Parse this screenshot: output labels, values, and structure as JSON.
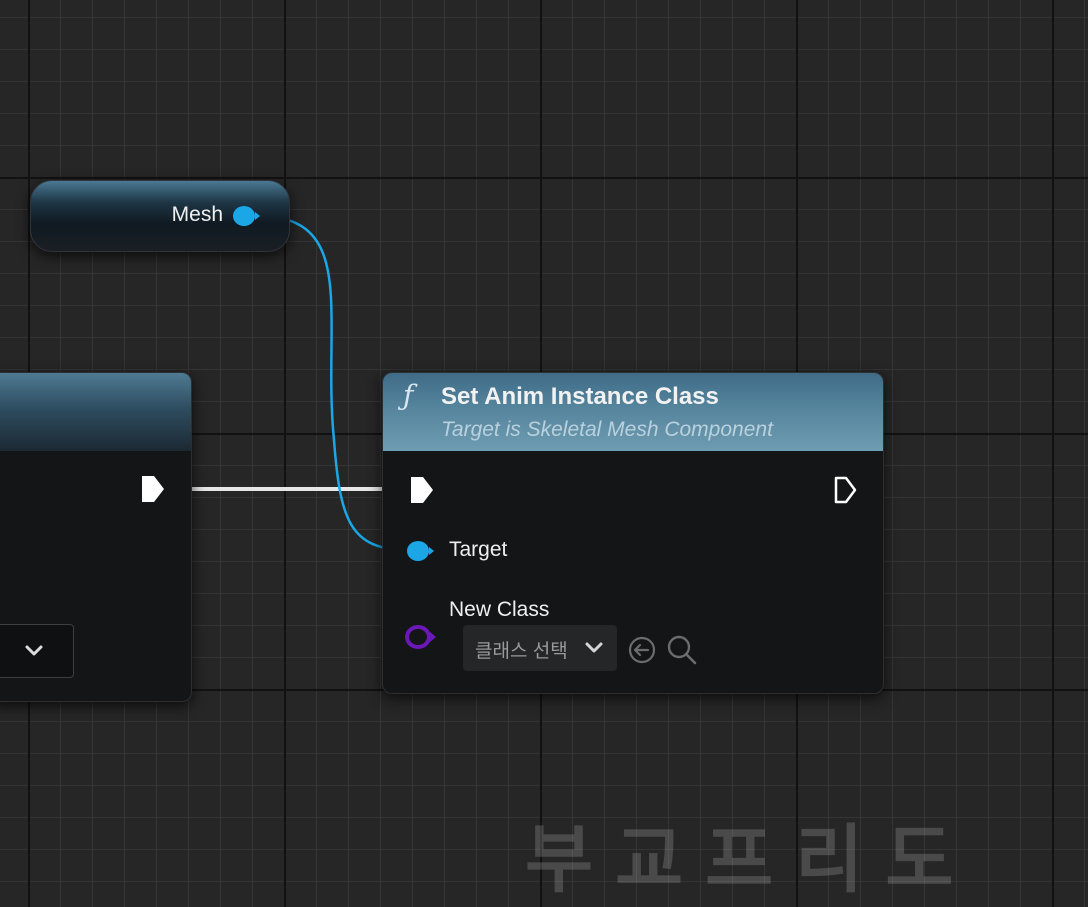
{
  "variable_node": {
    "label": "Mesh"
  },
  "function_node": {
    "icon": "function-icon",
    "title": "Set Anim Instance Class",
    "subtitle": "Target is Skeletal Mesh Component",
    "pins": {
      "target_label": "Target",
      "new_class_label": "New Class"
    },
    "class_select": {
      "value": "클래스 선택"
    }
  },
  "watermark": {
    "text": "부교프리도"
  },
  "colors": {
    "object_pin": "#1ba6e6",
    "class_pin": "#6a18b8",
    "exec_pin": "#ffffff",
    "header_blue": "#53829b"
  }
}
